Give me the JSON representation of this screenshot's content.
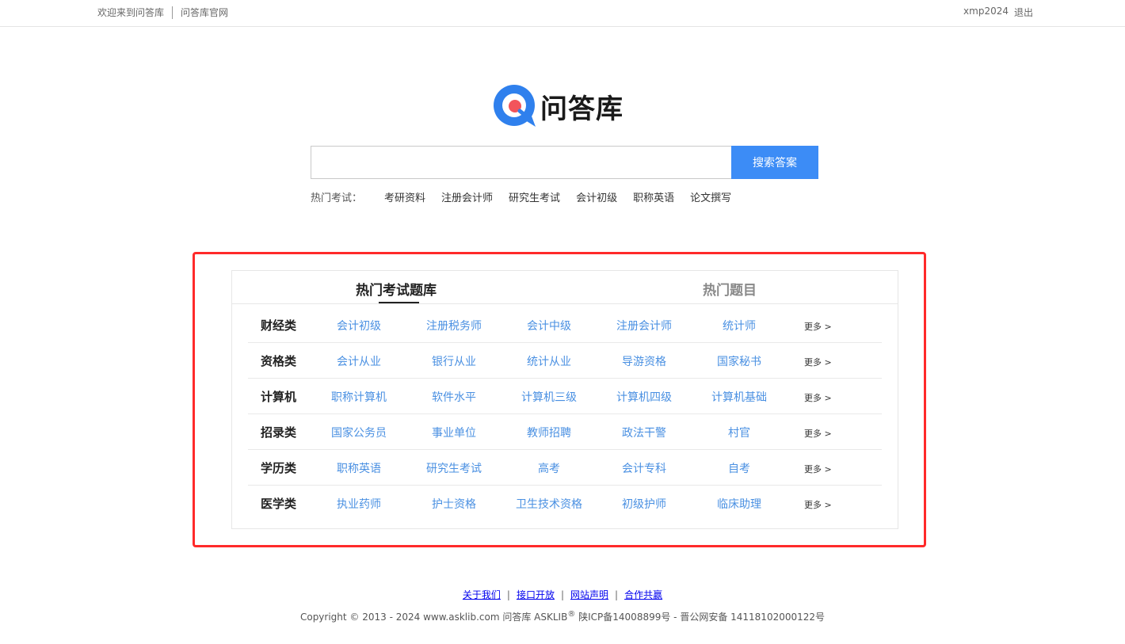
{
  "topbar": {
    "welcome": "欢迎来到问答库",
    "official": "问答库官网",
    "username": "xmp2024",
    "logout": "退出"
  },
  "logo": {
    "text": "问答库",
    "icon": "q-bubble-logo-icon",
    "brand_color": "#2f80ed",
    "dot_color": "#f2545b"
  },
  "search": {
    "value": "",
    "placeholder": "",
    "button": "搜索答案",
    "button_color": "#3c8cf6"
  },
  "hot": {
    "label": "热门考试：",
    "links": [
      "考研资料",
      "注册会计师",
      "研究生考试",
      "会计初级",
      "职称英语",
      "论文撰写"
    ]
  },
  "panel": {
    "tabs": [
      "热门考试题库",
      "热门题目"
    ],
    "more": "更多 >",
    "link_color": "#4a90e2",
    "rows": [
      {
        "category": "财经类",
        "items": [
          "会计初级",
          "注册税务师",
          "会计中级",
          "注册会计师",
          "统计师"
        ]
      },
      {
        "category": "资格类",
        "items": [
          "会计从业",
          "银行从业",
          "统计从业",
          "导游资格",
          "国家秘书"
        ]
      },
      {
        "category": "计算机",
        "items": [
          "职称计算机",
          "软件水平",
          "计算机三级",
          "计算机四级",
          "计算机基础"
        ]
      },
      {
        "category": "招录类",
        "items": [
          "国家公务员",
          "事业单位",
          "教师招聘",
          "政法干警",
          "村官"
        ]
      },
      {
        "category": "学历类",
        "items": [
          "职称英语",
          "研究生考试",
          "高考",
          "会计专科",
          "自考"
        ]
      },
      {
        "category": "医学类",
        "items": [
          "执业药师",
          "护士资格",
          "卫生技术资格",
          "初级护师",
          "临床助理"
        ]
      }
    ]
  },
  "highlight_color": "#ff2a2a",
  "footer": {
    "links": [
      "关于我们",
      "接口开放",
      "网站声明",
      "合作共赢"
    ],
    "divider": "|",
    "copyright_prefix": "Copyright © 2013 - 2024 www.asklib.com  问答库  ASKLIB",
    "registered": "®",
    "copyright_suffix": " 陕ICP备14008899号 - 晋公网安备 14118102000122号"
  }
}
